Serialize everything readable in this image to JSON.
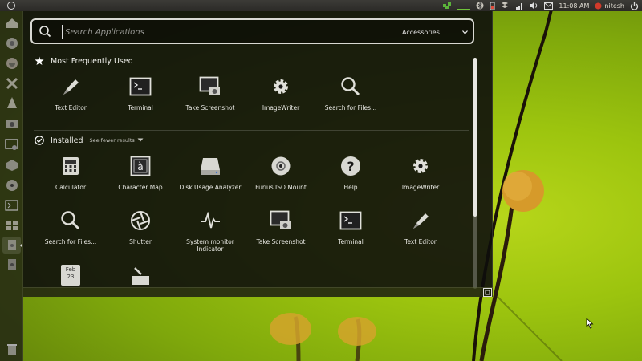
{
  "top_panel": {
    "clock": "11:08 AM",
    "user": "nitesh",
    "indicators": [
      "network-icon",
      "bluetooth-icon",
      "battery-icon",
      "dropbox-icon",
      "wifi-icon",
      "volume-icon",
      "mail-icon",
      "session-icon"
    ]
  },
  "launcher": {
    "items": [
      "dash-home-icon",
      "chrome-icon",
      "firefox-icon",
      "xampp-icon",
      "vlc-icon",
      "camera-icon",
      "screenshot-icon",
      "package-icon",
      "furius-icon",
      "terminal-icon",
      "workspaces-icon",
      "file-icon",
      "file-icon-2",
      "trash-icon"
    ]
  },
  "search": {
    "placeholder": "Search Applications",
    "filter_label": "Accessories"
  },
  "sections": {
    "frequent": {
      "title": "Most Frequently Used",
      "apps": [
        {
          "name": "Text Editor",
          "icon": "pen-icon"
        },
        {
          "name": "Terminal",
          "icon": "terminal-icon"
        },
        {
          "name": "Take Screenshot",
          "icon": "screenshot-icon"
        },
        {
          "name": "ImageWriter",
          "icon": "gear-icon"
        },
        {
          "name": "Search for Files...",
          "icon": "magnifier-icon"
        }
      ]
    },
    "installed": {
      "title": "Installed",
      "see_fewer": "See fewer results",
      "apps": [
        {
          "name": "Calculator",
          "icon": "calculator-icon"
        },
        {
          "name": "Character Map",
          "icon": "charmap-icon"
        },
        {
          "name": "Disk Usage Analyzer",
          "icon": "disk-icon"
        },
        {
          "name": "Furius ISO Mount",
          "icon": "cd-icon"
        },
        {
          "name": "Help",
          "icon": "help-icon"
        },
        {
          "name": "ImageWriter",
          "icon": "gear-icon"
        },
        {
          "name": "Search for Files...",
          "icon": "magnifier-icon"
        },
        {
          "name": "Shutter",
          "icon": "shutter-icon"
        },
        {
          "name": "System monitor Indicator",
          "icon": "pulse-icon"
        },
        {
          "name": "Take Screenshot",
          "icon": "screenshot-icon"
        },
        {
          "name": "Terminal",
          "icon": "terminal-icon"
        },
        {
          "name": "Text Editor",
          "icon": "pen-icon"
        }
      ],
      "partial_row": [
        {
          "icon": "calendar-icon",
          "month": "Feb",
          "day": "23"
        },
        {
          "icon": "box-icon"
        }
      ]
    }
  }
}
